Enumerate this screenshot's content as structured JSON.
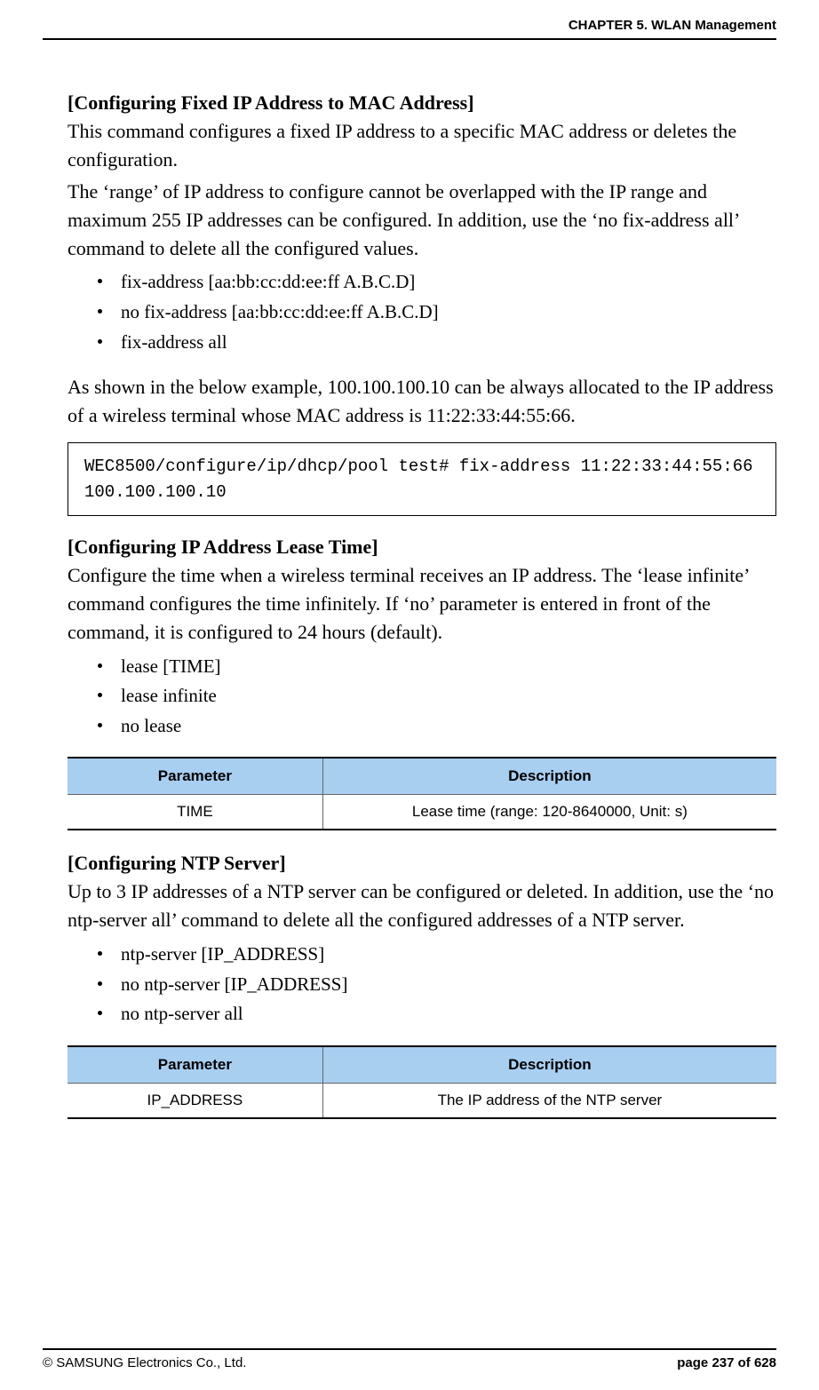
{
  "header": {
    "chapter": "CHAPTER 5. WLAN Management"
  },
  "sec1": {
    "title": "[Configuring Fixed IP Address to MAC Address]",
    "p1": "This command configures a fixed IP address to a specific MAC address or deletes the configuration.",
    "p2": "The ‘range’ of IP address to configure cannot be overlapped with the IP range and maximum 255 IP addresses can be configured. In addition, use the ‘no fix-address all’ command to delete all the configured values.",
    "items": [
      "fix-address [aa:bb:cc:dd:ee:ff A.B.C.D]",
      "no fix-address [aa:bb:cc:dd:ee:ff A.B.C.D]",
      "fix-address all"
    ],
    "p3": "As shown in the below example, 100.100.100.10 can be always allocated to the IP address of a wireless terminal whose MAC address is 11:22:33:44:55:66.",
    "code": "WEC8500/configure/ip/dhcp/pool test# fix-address 11:22:33:44:55:66 100.100.100.10"
  },
  "sec2": {
    "title": "[Configuring IP Address Lease Time]",
    "p1": "Configure the time when a wireless terminal receives an IP address. The ‘lease infinite’ command configures the time infinitely. If ‘no’ parameter is entered in front of the command, it is configured to 24 hours (default).",
    "items": [
      "lease [TIME]",
      "lease infinite",
      "no lease"
    ],
    "table": {
      "h1": "Parameter",
      "h2": "Description",
      "r1c1": "TIME",
      "r1c2": "Lease time (range: 120-8640000, Unit: s)"
    }
  },
  "sec3": {
    "title": "[Configuring NTP Server]",
    "p1": "Up to 3 IP addresses of a NTP server can be configured or deleted. In addition, use the ‘no ntp-server all’ command to delete all the configured addresses of a NTP server.",
    "items": [
      "ntp-server [IP_ADDRESS]",
      "no ntp-server [IP_ADDRESS]",
      "no ntp-server all"
    ],
    "table": {
      "h1": "Parameter",
      "h2": "Description",
      "r1c1": "IP_ADDRESS",
      "r1c2": "The IP address of the NTP server"
    }
  },
  "footer": {
    "copyright": "© SAMSUNG Electronics Co., Ltd.",
    "page": "page 237 of 628"
  }
}
